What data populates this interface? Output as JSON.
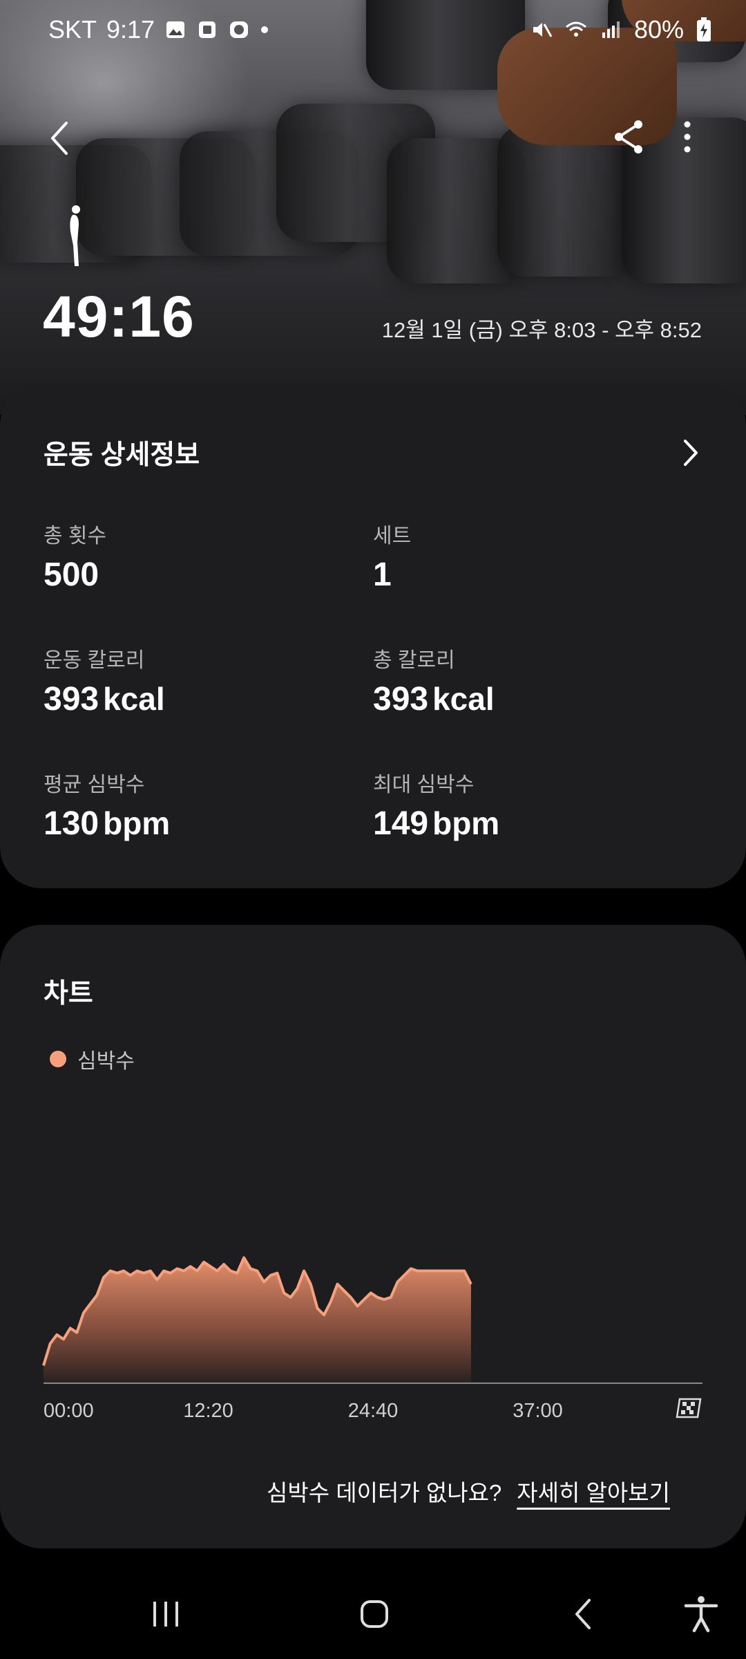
{
  "status_bar": {
    "carrier": "SKT",
    "time": "9:17",
    "battery": "80%",
    "icons": [
      "gallery-icon",
      "app-icon",
      "chat-icon",
      "dot-icon",
      "mute-icon",
      "wifi-icon",
      "signal-icon",
      "battery-icon"
    ]
  },
  "header": {
    "duration": "49:16",
    "datetime": "12월 1일 (금) 오후 8:03 - 오후 8:52"
  },
  "details": {
    "title": "운동 상세정보",
    "stats": [
      {
        "label": "총 횟수",
        "value": "500",
        "unit": ""
      },
      {
        "label": "세트",
        "value": "1",
        "unit": ""
      },
      {
        "label": "운동 칼로리",
        "value": "393",
        "unit": "kcal"
      },
      {
        "label": "총 칼로리",
        "value": "393",
        "unit": "kcal"
      },
      {
        "label": "평균 심박수",
        "value": "130",
        "unit": "bpm"
      },
      {
        "label": "최대 심박수",
        "value": "149",
        "unit": "bpm"
      }
    ]
  },
  "chart_section": {
    "title": "차트",
    "legend": "심박수",
    "no_data_text": "심박수 데이터가 없나요?",
    "learn_more": "자세히 알아보기"
  },
  "chart_data": {
    "type": "area",
    "series": [
      {
        "name": "심박수",
        "color": "#f7a07e"
      }
    ],
    "x_ticks": [
      "00:00",
      "12:20",
      "24:40",
      "37:00"
    ],
    "x_minutes": [
      0,
      0.5,
      1,
      1.5,
      2,
      2.5,
      3,
      3.5,
      4,
      4.5,
      5,
      5.5,
      6,
      6.5,
      7,
      7.5,
      8,
      8.5,
      9,
      9.5,
      10,
      10.5,
      11,
      11.5,
      12,
      12.5,
      13,
      13.5,
      14,
      14.5,
      15,
      15.5,
      16,
      16.5,
      17,
      17.5,
      18,
      18.5,
      19,
      19.5,
      20,
      20.5,
      21,
      21.5,
      22,
      22.5,
      23,
      23.5,
      24,
      24.5,
      25,
      25.5,
      26,
      26.5,
      27,
      27.5,
      28,
      28.5,
      29,
      29.5,
      30,
      30.5,
      31,
      31.5,
      32
    ],
    "y_bpm": [
      98,
      108,
      112,
      110,
      115,
      113,
      122,
      126,
      130,
      138,
      141,
      140,
      141,
      139,
      141,
      140,
      141,
      137,
      141,
      140,
      142,
      141,
      143,
      141,
      145,
      143,
      141,
      144,
      141,
      140,
      147,
      142,
      141,
      136,
      139,
      140,
      131,
      129,
      133,
      141,
      135,
      124,
      121,
      127,
      135,
      132,
      129,
      125,
      128,
      131,
      129,
      128,
      129,
      136,
      139,
      142,
      141,
      141,
      141,
      141,
      141,
      141,
      141,
      141,
      135
    ],
    "ylim": [
      90,
      160
    ],
    "xlim": [
      0,
      49.33
    ]
  },
  "nav": {
    "icons": [
      "recents-icon",
      "home-icon",
      "back-icon",
      "accessibility-icon"
    ]
  }
}
